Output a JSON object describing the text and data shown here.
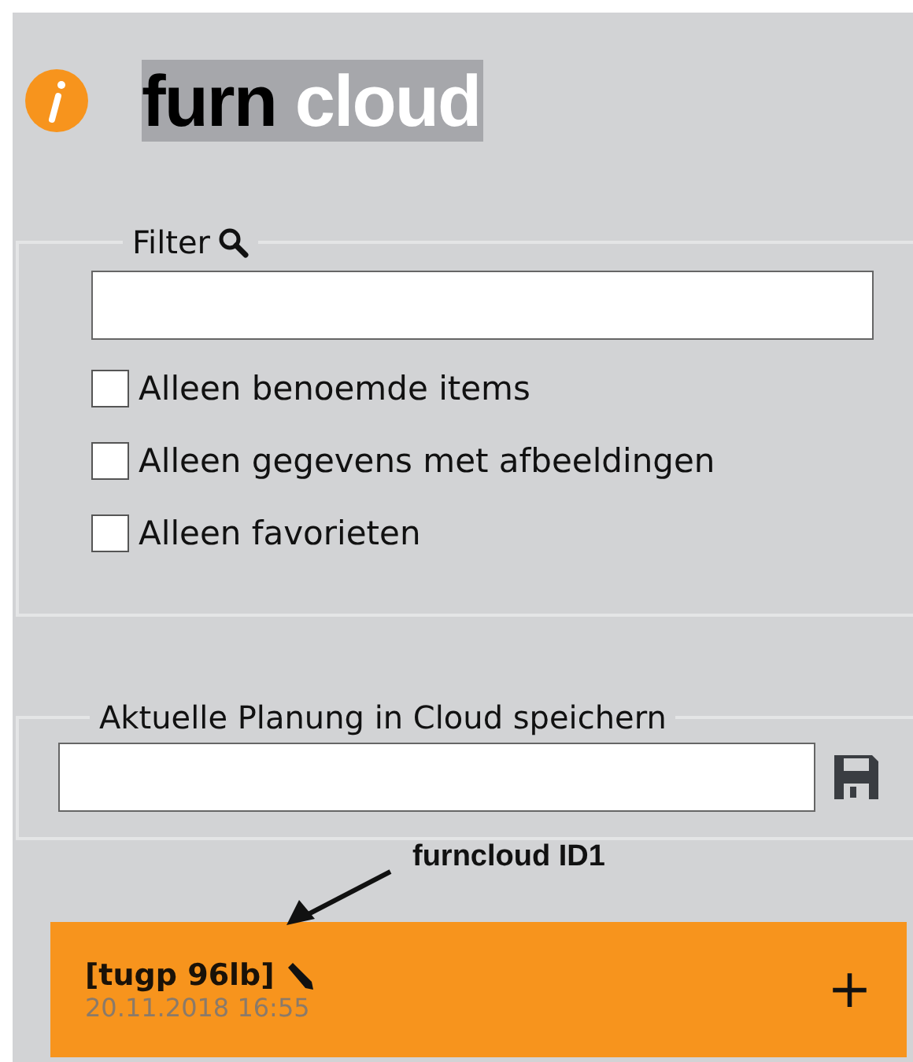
{
  "logo": {
    "part_1": "furn",
    "part_2": "cloud"
  },
  "filter": {
    "legend": "Filter",
    "options": [
      {
        "label": "Alleen benoemde items",
        "checked": false
      },
      {
        "label": "Alleen gegevens met afbeeldingen",
        "checked": false
      },
      {
        "label": "Alleen favorieten",
        "checked": false
      }
    ]
  },
  "save": {
    "legend": "Aktuelle Planung in Cloud speichern"
  },
  "annotation": "furncloud ID1",
  "entries": [
    {
      "title": "[tugp 96lb]",
      "date": "20.11.2018 16:55",
      "expand": "+"
    }
  ]
}
